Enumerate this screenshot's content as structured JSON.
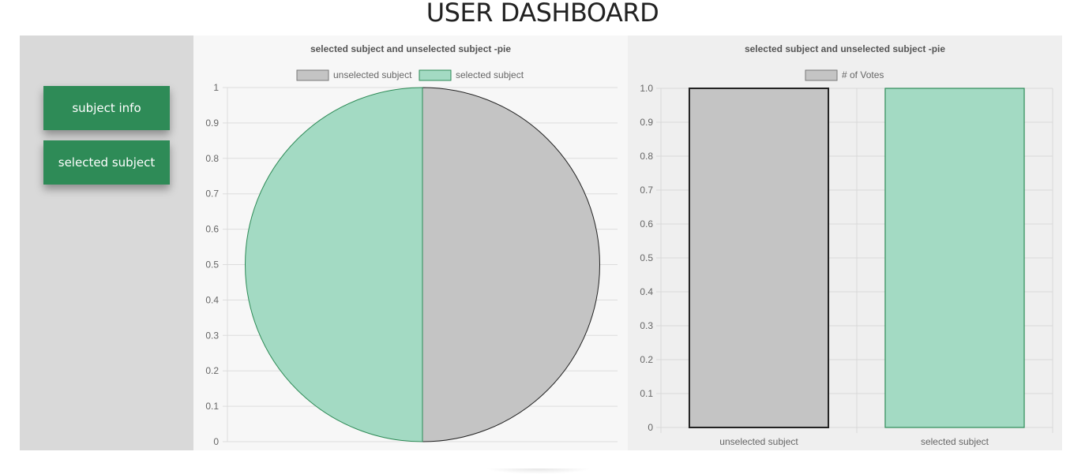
{
  "header": {
    "title": "USER DASHBOARD"
  },
  "sidebar": {
    "buttons": [
      {
        "label": "subject info"
      },
      {
        "label": "selected subject"
      }
    ]
  },
  "colors": {
    "unselected": "#c4c4c4",
    "unselected_border": "#222222",
    "selected": "#a3dac3",
    "selected_border": "#2e8b57",
    "button": "#2e8b57"
  },
  "chart_data": [
    {
      "type": "pie",
      "title": "selected subject and unselected subject -pie",
      "legend_position": "top",
      "grid": true,
      "ylim": [
        0,
        1
      ],
      "y_ticks": [
        "0",
        "0.1",
        "0.2",
        "0.3",
        "0.4",
        "0.5",
        "0.6",
        "0.7",
        "0.8",
        "0.9",
        "1"
      ],
      "categories": [
        "unselected subject",
        "selected subject"
      ],
      "values": [
        1,
        1
      ]
    },
    {
      "type": "bar",
      "title": "selected subject and unselected subject -pie",
      "legend_position": "top",
      "grid": true,
      "ylim": [
        0,
        1
      ],
      "y_ticks": [
        "0",
        "0.1",
        "0.2",
        "0.3",
        "0.4",
        "0.5",
        "0.6",
        "0.7",
        "0.8",
        "0.9",
        "1.0"
      ],
      "categories": [
        "unselected subject",
        "selected subject"
      ],
      "series": [
        {
          "name": "# of Votes",
          "values": [
            1,
            1
          ]
        }
      ]
    }
  ]
}
